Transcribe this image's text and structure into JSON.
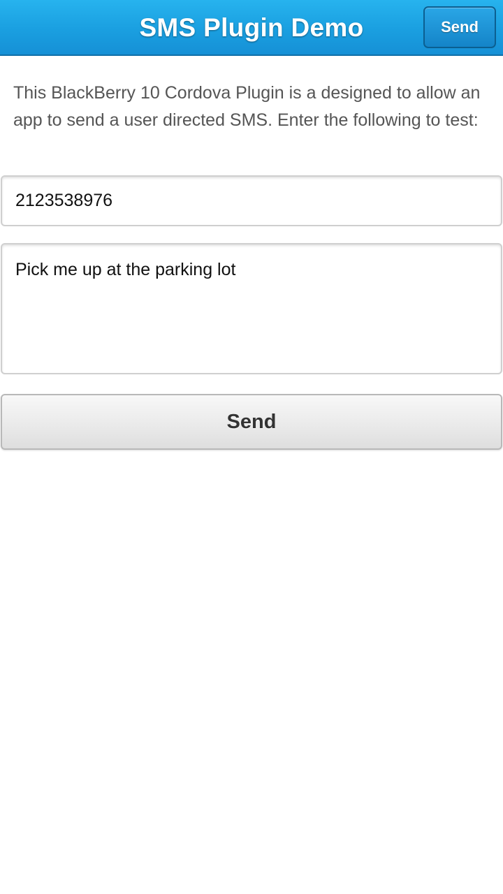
{
  "header": {
    "title": "SMS Plugin Demo",
    "send_label": "Send"
  },
  "intro": {
    "text": "This BlackBerry 10 Cordova Plugin is a designed to allow an app to send a user directed SMS. Enter the following to test:"
  },
  "form": {
    "phone_value": "2123538976",
    "message_value": "Pick me up at the parking lot",
    "send_label": "Send"
  },
  "colors": {
    "header_blue": "#1a9fe0",
    "header_button_blue": "#1484c8",
    "button_gray": "#e9e9e9",
    "intro_text": "#555555"
  }
}
